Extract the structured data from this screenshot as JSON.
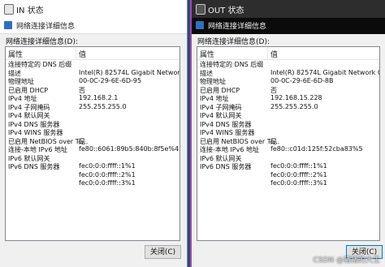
{
  "left": {
    "title": "IN 状态",
    "dialog_title": "网络连接详细信息",
    "details_label": "网络连接详细信息(D):",
    "header": {
      "property": "属性",
      "value": "值"
    },
    "rows": [
      {
        "prop": "连接特定的 DNS 后缀",
        "val": ""
      },
      {
        "prop": "描述",
        "val": "Intel(R) 82574L Gigabit Network Conne"
      },
      {
        "prop": "物理地址",
        "val": "00-0C-29-6E-6D-95"
      },
      {
        "prop": "已启用 DHCP",
        "val": "否"
      },
      {
        "prop": "IPv4 地址",
        "val": "192.168.2.1"
      },
      {
        "prop": "IPv4 子网掩码",
        "val": "255.255.255.0"
      },
      {
        "prop": "IPv4 默认网关",
        "val": ""
      },
      {
        "prop": "IPv4 DNS 服务器",
        "val": ""
      },
      {
        "prop": "IPv4 WINS 服务器",
        "val": ""
      },
      {
        "prop": "已启用 NetBIOS over Tc...",
        "val": "是"
      },
      {
        "prop": "连接-本地 IPv6 地址",
        "val": "fe80::6061:89b5:840b:8f5e%4"
      },
      {
        "prop": "IPv6 默认网关",
        "val": ""
      },
      {
        "prop": "IPv6 DNS 服务器",
        "val": "fec0:0:0:ffff::1%1"
      },
      {
        "prop": "",
        "val": "fec0:0:0:ffff::2%1"
      },
      {
        "prop": "",
        "val": "fec0:0:0:ffff::3%1"
      }
    ],
    "close_label": "关闭(C)"
  },
  "right": {
    "title": "OUT 状态",
    "dialog_title": "网络连接详细信息",
    "details_label": "网络连接详细信息(D):",
    "header": {
      "property": "属性",
      "value": "值"
    },
    "rows": [
      {
        "prop": "连接特定的 DNS 后缀",
        "val": ""
      },
      {
        "prop": "描述",
        "val": "Intel(R) 82574L Gigabit Network Conne"
      },
      {
        "prop": "物理地址",
        "val": "00-0C-29-6E-6D-8B"
      },
      {
        "prop": "已启用 DHCP",
        "val": "否"
      },
      {
        "prop": "IPv4 地址",
        "val": "192.168.15.228"
      },
      {
        "prop": "IPv4 子网掩码",
        "val": "255.255.255.0"
      },
      {
        "prop": "IPv4 默认网关",
        "val": ""
      },
      {
        "prop": "IPv4 DNS 服务器",
        "val": ""
      },
      {
        "prop": "IPv4 WINS 服务器",
        "val": ""
      },
      {
        "prop": "已启用 NetBIOS over Tc...",
        "val": "是"
      },
      {
        "prop": "连接-本地 IPv6 地址",
        "val": "fe80::c01d:125f:52cba83%5"
      },
      {
        "prop": "IPv6 默认网关",
        "val": ""
      },
      {
        "prop": "IPv6 DNS 服务器",
        "val": "fec0:0:0:ffff::1%1"
      },
      {
        "prop": "",
        "val": "fec0:0:0:ffff::2%1"
      },
      {
        "prop": "",
        "val": "fec0:0:0:ffff::3%1"
      }
    ],
    "close_label": "关闭(C)"
  },
  "watermark": "CSDN @猪猪的大王"
}
